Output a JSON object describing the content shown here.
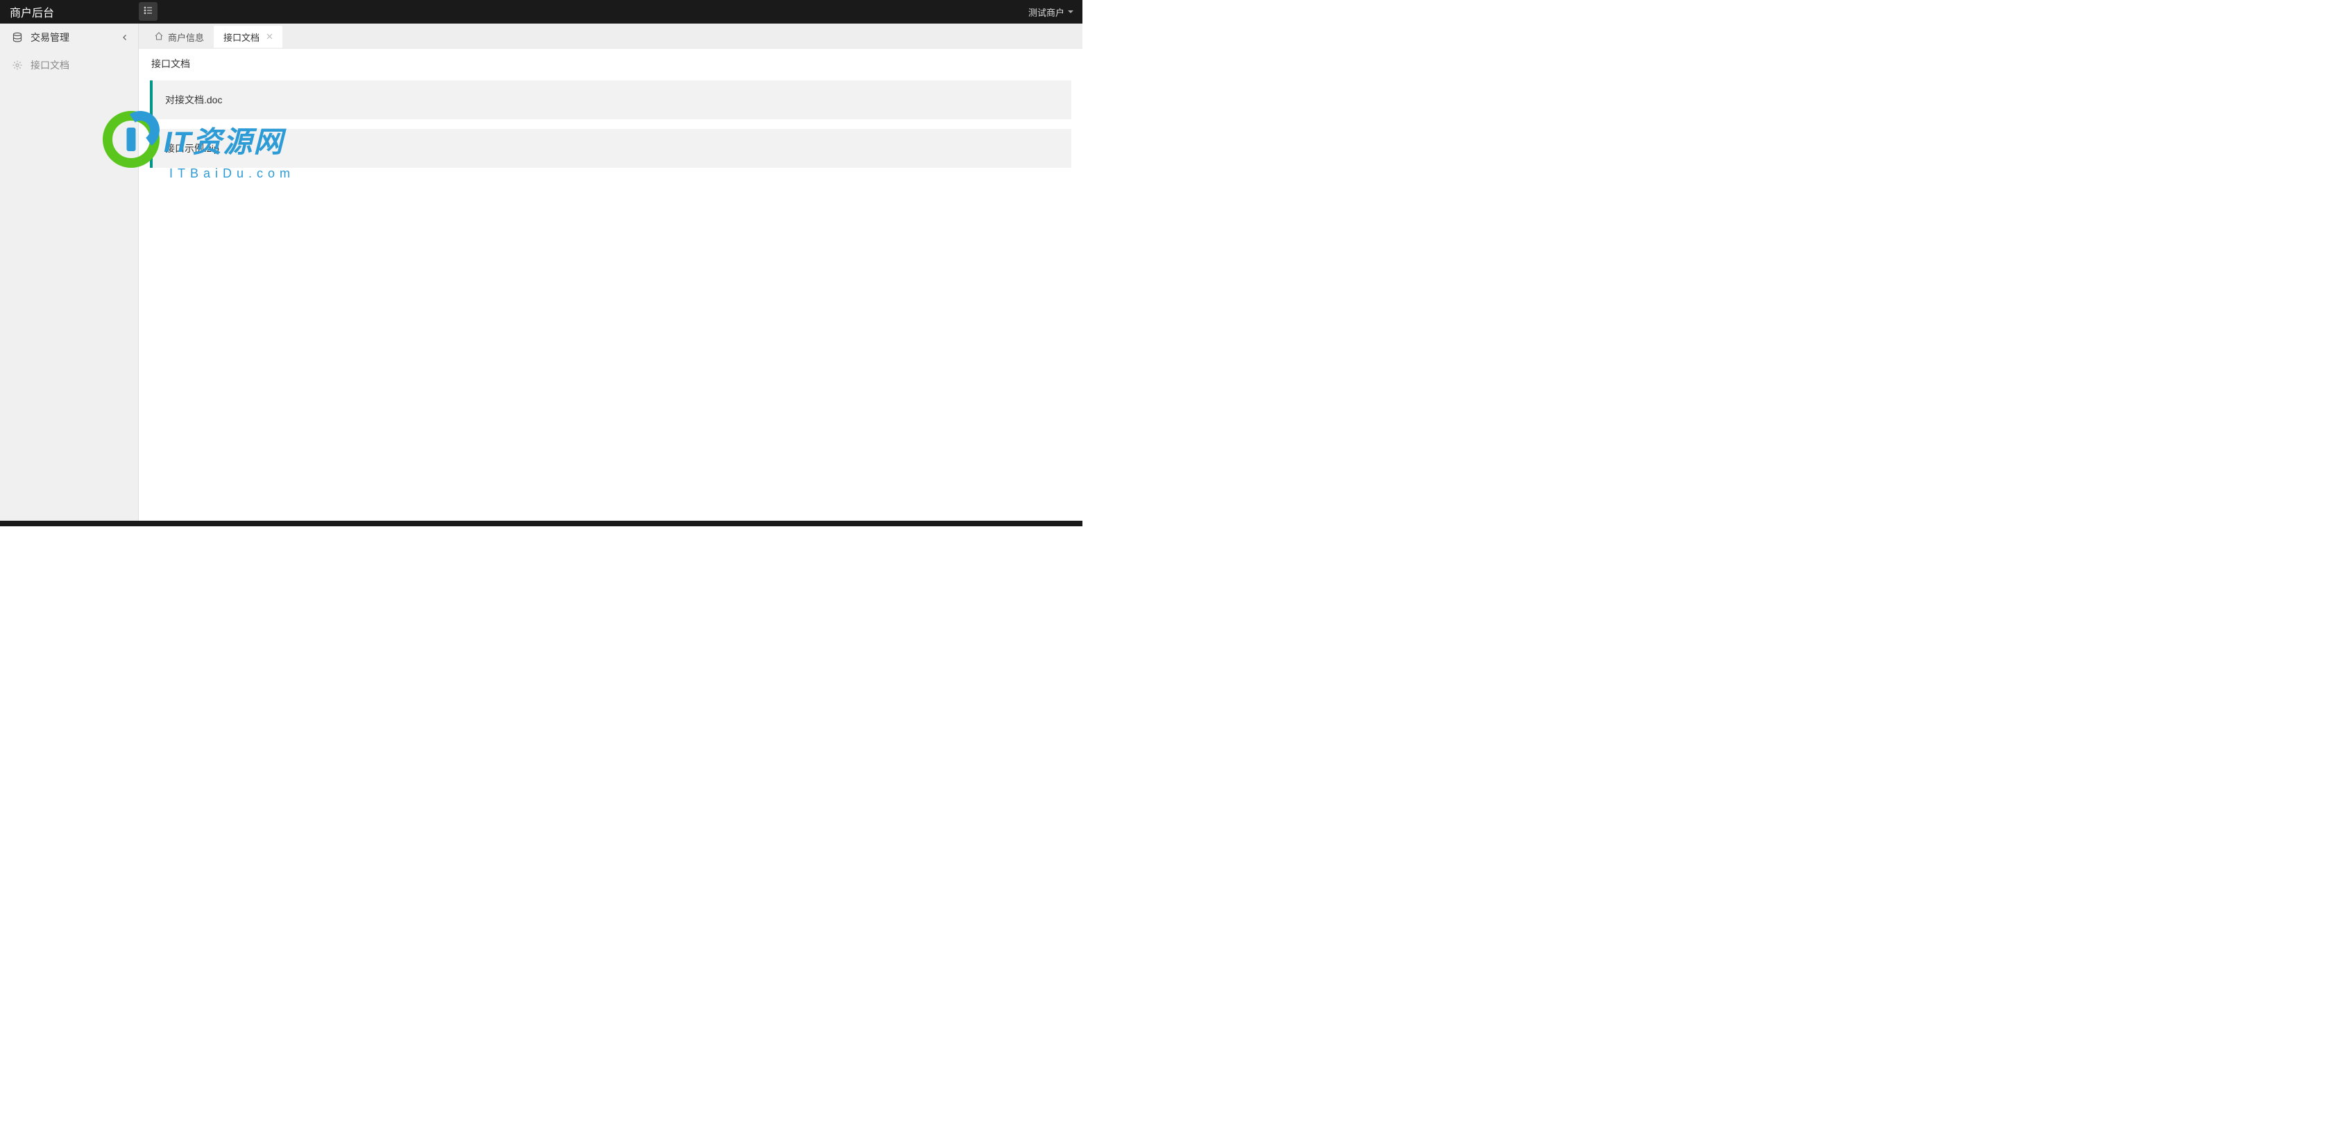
{
  "header": {
    "app_title": "商户后台",
    "user_label": "测试商户"
  },
  "sidebar": {
    "items": [
      {
        "icon": "database-icon",
        "label": "交易管理",
        "expandable": true
      },
      {
        "icon": "gear-icon",
        "label": "接口文档",
        "expandable": false
      }
    ]
  },
  "tabs": [
    {
      "icon": "home-icon",
      "label": "商户信息",
      "closable": false,
      "active": false
    },
    {
      "icon": null,
      "label": "接口文档",
      "closable": true,
      "active": true
    }
  ],
  "page": {
    "title": "接口文档",
    "files": [
      {
        "name": "对接文档.doc"
      },
      {
        "name": "接口示例.zip"
      }
    ]
  },
  "watermark": {
    "logo_text_prefix": "IT",
    "logo_text_main": "资源网",
    "subdomain": "ITBaiDu.com"
  }
}
